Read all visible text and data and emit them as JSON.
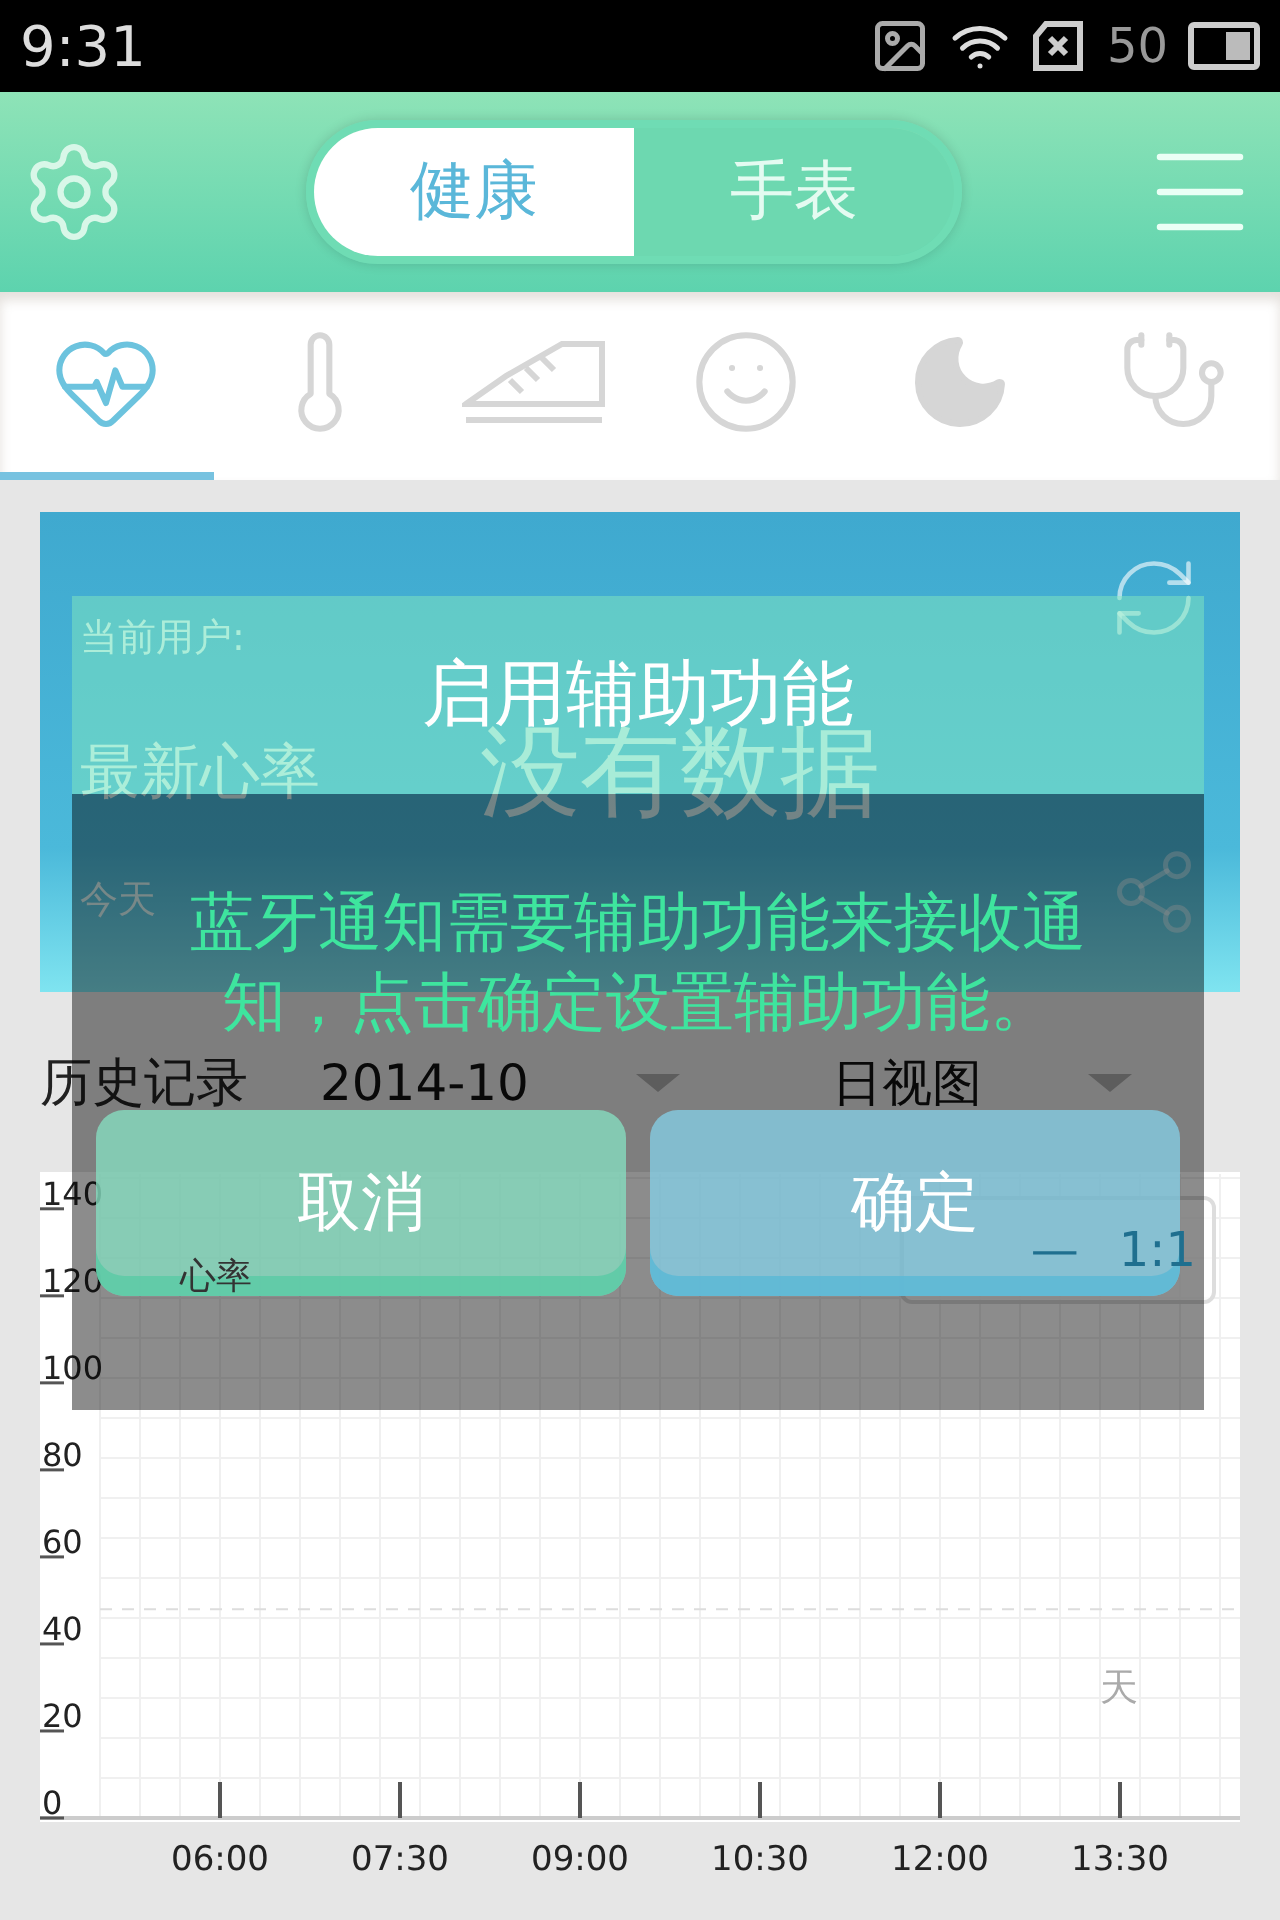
{
  "status_bar": {
    "time": "9:31",
    "battery": "50"
  },
  "header": {
    "segments": [
      {
        "label": "健康",
        "selected": true
      },
      {
        "label": "手表",
        "selected": false
      }
    ]
  },
  "category_tabs": [
    {
      "kind": "heart",
      "selected": true
    },
    {
      "kind": "thermometer",
      "selected": false
    },
    {
      "kind": "shoe",
      "selected": false
    },
    {
      "kind": "smile",
      "selected": false
    },
    {
      "kind": "moon",
      "selected": false
    },
    {
      "kind": "stethoscope",
      "selected": false
    }
  ],
  "summary_card": {
    "user_label": "当前用户:",
    "heart_rate_label": "最新心率",
    "no_data": "没有数据",
    "today_label": "今天"
  },
  "history": {
    "label": "历史记录",
    "month": "2014-10",
    "view": "日视图"
  },
  "chart": {
    "zoom_controls": [
      "—",
      "1:1"
    ],
    "chart_data": {
      "type": "line",
      "title": "心率",
      "annotations": [
        "天"
      ],
      "grid": true,
      "ref_lines": [
        {
          "axis": "y",
          "value": 48
        }
      ],
      "xlim": [
        5,
        14.5
      ],
      "ylim": [
        0,
        148
      ],
      "yticks": [
        0,
        20,
        40,
        60,
        80,
        100,
        120,
        140
      ],
      "xticks": [
        {
          "value": 6,
          "label": "06:00"
        },
        {
          "value": 7.5,
          "label": "07:30"
        },
        {
          "value": 9,
          "label": "09:00"
        },
        {
          "value": 10.5,
          "label": "10:30"
        },
        {
          "value": 12,
          "label": "12:00"
        },
        {
          "value": 13.5,
          "label": "13:30"
        }
      ]
    }
  },
  "dialog": {
    "title": "启用辅助功能",
    "message": "蓝牙通知需要辅助功能来接收通知，点击确定设置辅助功能。",
    "buttons": [
      {
        "kind": "cancel",
        "label": "取消"
      },
      {
        "kind": "confirm",
        "label": "确定"
      }
    ]
  }
}
